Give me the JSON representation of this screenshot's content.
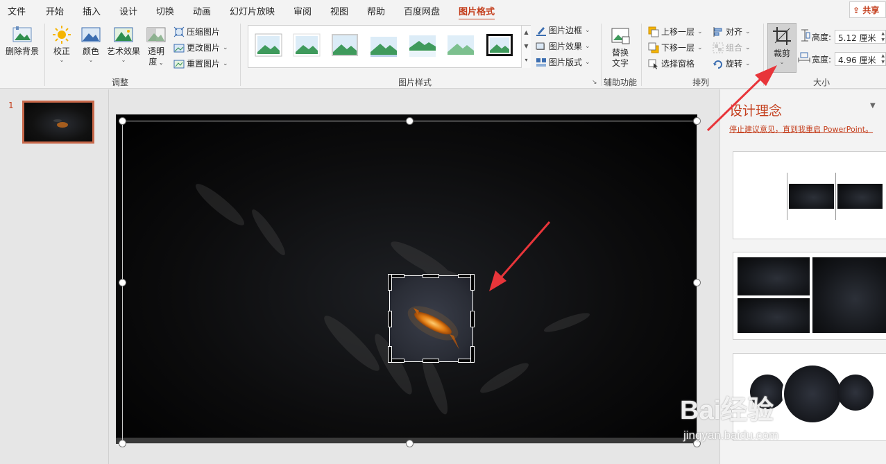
{
  "tabs": [
    "文件",
    "开始",
    "插入",
    "设计",
    "切换",
    "动画",
    "幻灯片放映",
    "审阅",
    "视图",
    "帮助",
    "百度网盘",
    "图片格式"
  ],
  "active_tab": "图片格式",
  "share_label": "共享",
  "ribbon": {
    "remove_bg": "删除背景",
    "correct": "校正",
    "color": "颜色",
    "artistic": "艺术效果",
    "transparency_1": "透明",
    "transparency_2": "度",
    "compress": "压缩图片",
    "change": "更改图片",
    "reset": "重置图片",
    "group_adjust": "调整",
    "border": "图片边框",
    "effects": "图片效果",
    "layout": "图片版式",
    "group_styles": "图片样式",
    "alt_text_1": "替换",
    "alt_text_2": "文字",
    "group_access": "辅助功能",
    "bring_forward": "上移一层",
    "send_backward": "下移一层",
    "selection_pane": "选择窗格",
    "align": "对齐",
    "group_obj": "组合",
    "rotate": "旋转",
    "group_arrange": "排列",
    "crop": "裁剪",
    "height_label": "高度:",
    "height_value": "5.12 厘米",
    "width_label": "宽度:",
    "width_value": "4.96 厘米",
    "group_size": "大小"
  },
  "thumbnail": {
    "number": "1"
  },
  "design_pane": {
    "title": "设计理念",
    "stop_link": "停止建议意见，直到我重启 PowerPoint。"
  },
  "watermark": {
    "logo": "Bai经验",
    "url": "jingyan.baidu.com"
  },
  "colors": {
    "accent": "#c43e1c",
    "annotation_arrow": "#e8353a"
  }
}
